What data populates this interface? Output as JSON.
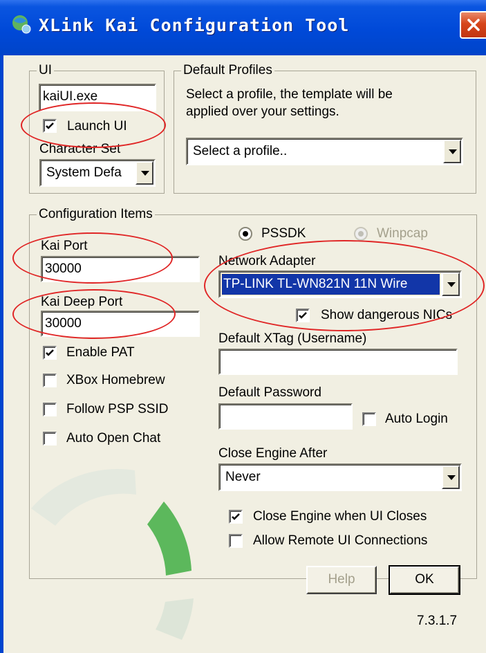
{
  "window": {
    "title": "XLink Kai Configuration Tool"
  },
  "ui_group": {
    "legend": "UI",
    "exe_value": "kaiUI.exe",
    "launch_ui_label": "Launch UI",
    "launch_ui_checked": true,
    "charset_label": "Character Set",
    "charset_value": "System Defa"
  },
  "profiles_group": {
    "legend": "Default Profiles",
    "description_line1": "Select a profile, the template will be",
    "description_line2": "applied over your settings.",
    "profile_value": "Select a profile.."
  },
  "config_group": {
    "legend": "Configuration Items",
    "kai_port_label": "Kai Port",
    "kai_port_value": "30000",
    "kai_deep_port_label": "Kai Deep Port",
    "kai_deep_port_value": "30000",
    "enable_pat_label": "Enable PAT",
    "enable_pat_checked": true,
    "xbox_homebrew_label": "XBox Homebrew",
    "follow_psp_ssid_label": "Follow PSP SSID",
    "auto_open_chat_label": "Auto Open Chat",
    "pssdk_label": "PSSDK",
    "winpcap_label": "Winpcap",
    "capture_mode": "PSSDK",
    "network_adapter_label": "Network Adapter",
    "network_adapter_value": "TP-LINK TL-WN821N 11N Wire",
    "show_dangerous_label": "Show dangerous NICs",
    "show_dangerous_checked": true,
    "xtag_label": "Default XTag (Username)",
    "xtag_value": "",
    "password_label": "Default Password",
    "password_value": "",
    "auto_login_label": "Auto Login",
    "close_engine_after_label": "Close Engine After",
    "close_engine_after_value": "Never",
    "close_engine_ui_label": "Close Engine when UI Closes",
    "close_engine_ui_checked": true,
    "allow_remote_label": "Allow Remote UI Connections"
  },
  "buttons": {
    "help_label": "Help",
    "ok_label": "OK"
  },
  "version": "7.3.1.7",
  "colors": {
    "titlebar": "#0049d8",
    "selection": "#1236a8",
    "annotation": "#e02626",
    "logo_green": "#5cb85c"
  }
}
